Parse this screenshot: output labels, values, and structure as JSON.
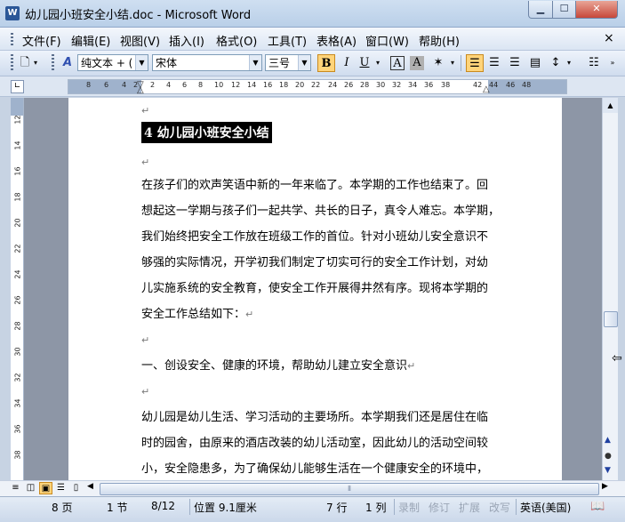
{
  "window": {
    "title": "幼儿园小班安全小结.doc - Microsoft Word",
    "app_icon": "W",
    "min_icon": "minimize-icon",
    "max_icon": "maximize-icon",
    "close_icon": "close-icon"
  },
  "menu": {
    "items": [
      "文件(F)",
      "编辑(E)",
      "视图(V)",
      "插入(I)",
      "格式(O)",
      "工具(T)",
      "表格(A)",
      "窗口(W)",
      "帮助(H)"
    ],
    "close_glyph": "×"
  },
  "toolbar": {
    "style_value": "纯文本 + (",
    "font_value": "宋体",
    "size_value": "三号",
    "bold": "B",
    "italic": "I",
    "underline": "U",
    "char_border": "A",
    "char_shading": "A"
  },
  "ruler": {
    "ticks": [
      "8",
      "6",
      "4",
      "2",
      "2",
      "4",
      "6",
      "8",
      "10",
      "12",
      "14",
      "16",
      "18",
      "20",
      "22",
      "24",
      "26",
      "28",
      "30",
      "32",
      "34",
      "36",
      "38",
      "42",
      "44",
      "46",
      "48"
    ]
  },
  "vruler": {
    "ticks": [
      "12",
      "14",
      "16",
      "18",
      "20",
      "22",
      "24",
      "26",
      "28",
      "30",
      "32",
      "34",
      "36",
      "38"
    ]
  },
  "document": {
    "blank_mark": "↵",
    "heading": "4 幼儿园小班安全小结",
    "lines": [
      "在孩子们的欢声笑语中新的一年来临了。本学期的工作也结束了。回",
      "想起这一学期与孩子们一起共学、共长的日子，真令人难忘。本学期，",
      "我们始终把安全工作放在班级工作的首位。针对小班幼儿安全意识不",
      "够强的实际情况，开学初我们制定了切实可行的安全工作计划，对幼",
      "儿实施系统的安全教育，使安全工作开展得井然有序。现将本学期的",
      "安全工作总结如下："
    ],
    "section1": "一、创设安全、健康的环境，帮助幼儿建立安全意识",
    "lines2": [
      "幼儿园是幼儿生活、学习活动的主要场所。本学期我们还是居住在临",
      "时的园舍，由原来的酒店改装的幼儿活动室，因此幼儿的活动空间较",
      "小，安全隐患多，为了确保幼儿能够生活在一个健康安全的环境中，"
    ]
  },
  "status": {
    "page": "8 页",
    "section": "1 节",
    "page_of": "8/12",
    "position": "位置 9.1厘米",
    "line": "7 行",
    "col": "1 列",
    "rec": "录制",
    "trk": "修订",
    "ext": "扩展",
    "ovr": "改写",
    "lang": "英语(美国)"
  }
}
